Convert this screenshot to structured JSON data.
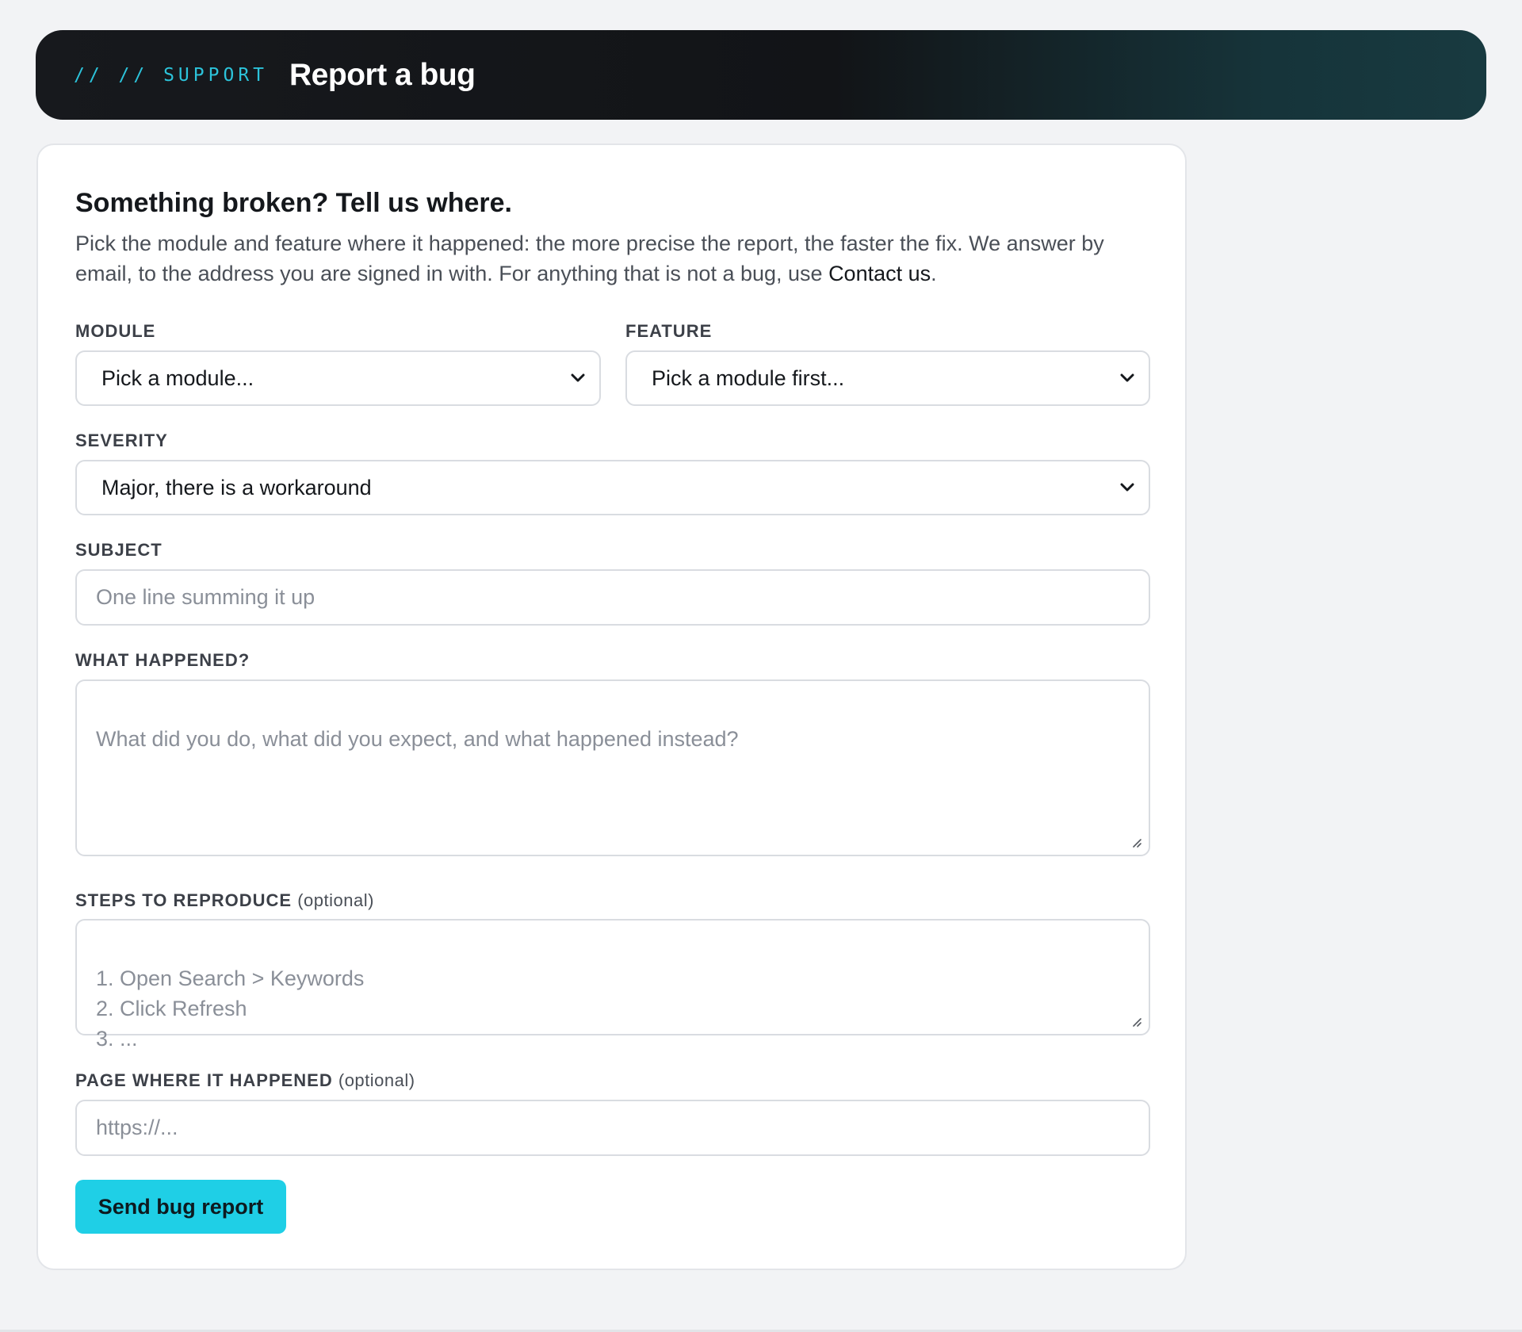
{
  "header": {
    "eyebrow": "// // SUPPORT",
    "title": "Report a bug",
    "accent_color": "#2cc3da"
  },
  "form": {
    "heading": "Something broken? Tell us where.",
    "intro_text": "Pick the module and feature where it happened: the more precise the report, the faster the fix. We answer by email, to the address you are signed in with. For anything that is not a bug, use ",
    "intro_link": "Contact us",
    "intro_end": ".",
    "module": {
      "label": "MODULE",
      "value": "Pick a module..."
    },
    "feature": {
      "label": "FEATURE",
      "value": "Pick a module first..."
    },
    "severity": {
      "label": "SEVERITY",
      "value": "Major, there is a workaround"
    },
    "subject": {
      "label": "SUBJECT",
      "placeholder": "One line summing it up"
    },
    "what_happened": {
      "label": "WHAT HAPPENED?",
      "placeholder": "What did you do, what did you expect, and what happened instead?"
    },
    "steps": {
      "label": "STEPS TO REPRODUCE",
      "optional": "(optional)",
      "placeholder": "1. Open Search > Keywords\n2. Click Refresh\n3. ..."
    },
    "page": {
      "label": "PAGE WHERE IT HAPPENED",
      "optional": "(optional)",
      "placeholder": "https://..."
    },
    "submit_label": "Send bug report",
    "button_color": "#1fcfe6"
  }
}
